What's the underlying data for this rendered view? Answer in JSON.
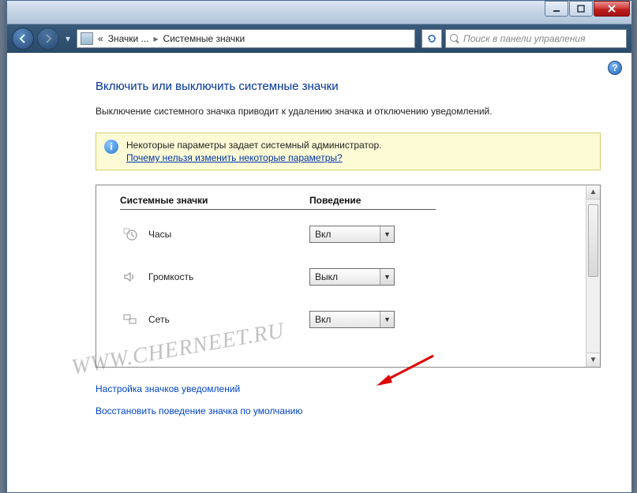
{
  "breadcrumb": {
    "root_chevrons": "«",
    "item1": "Значки ...",
    "item2": "Системные значки"
  },
  "search": {
    "placeholder": "Поиск в панели управления"
  },
  "page": {
    "title": "Включить или выключить системные значки",
    "description": "Выключение системного значка приводит к удалению значка и отключению уведомлений."
  },
  "banner": {
    "line1": "Некоторые параметры задает системный администратор.",
    "link": "Почему нельзя изменить некоторые параметры?"
  },
  "table": {
    "col1": "Системные значки",
    "col2": "Поведение",
    "rows": [
      {
        "icon": "clock-icon",
        "label": "Часы",
        "value": "Вкл"
      },
      {
        "icon": "speaker-icon",
        "label": "Громкость",
        "value": "Выкл"
      },
      {
        "icon": "network-icon",
        "label": "Сеть",
        "value": "Вкл"
      }
    ]
  },
  "links": {
    "customize": "Настройка значков уведомлений",
    "restore": "Восстановить поведение значка по умолчанию"
  },
  "watermark": "WWW.CHERNEET.RU"
}
